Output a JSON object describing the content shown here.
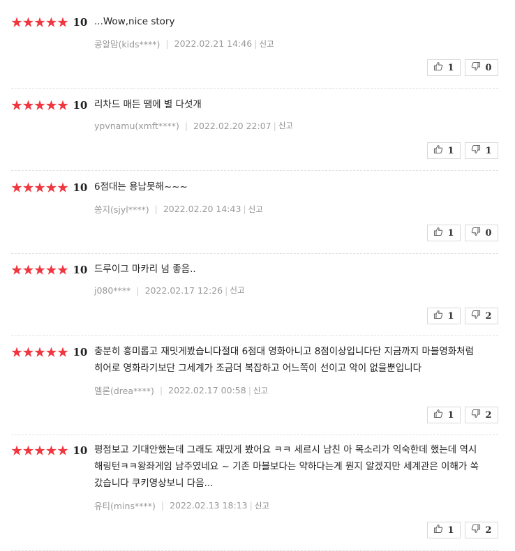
{
  "reviews": [
    {
      "score": "10",
      "text": "...Wow,nice story",
      "author": "콩알맘(kids****)",
      "date": "2022.02.21 14:46",
      "report": "신고",
      "likes": "1",
      "dislikes": "0"
    },
    {
      "score": "10",
      "text": "리차드 매든 땜에 별 다섯개",
      "author": "ypvnamu(xmft****)",
      "date": "2022.02.20 22:07",
      "report": "신고",
      "likes": "1",
      "dislikes": "1"
    },
    {
      "score": "10",
      "text": "6점대는 용납못해~~~",
      "author": "쏭지(sjyl****)",
      "date": "2022.02.20 14:43",
      "report": "신고",
      "likes": "1",
      "dislikes": "0"
    },
    {
      "score": "10",
      "text": "드루이그 마카리 넘 좋음..",
      "author": "j080****",
      "date": "2022.02.17 12:26",
      "report": "신고",
      "likes": "1",
      "dislikes": "2"
    },
    {
      "score": "10",
      "text": "충분히 흥미롭고 재밋게봤습니다절대 6점대 영화아니고 8점이상입니다단 지금까지 마블영화처럼 히어로 영화라기보단 그세계가 조금더 복잡하고 어느쪽이 선이고 악이 없을뿐입니다",
      "author": "멜론(drea****)",
      "date": "2022.02.17 00:58",
      "report": "신고",
      "likes": "1",
      "dislikes": "2"
    },
    {
      "score": "10",
      "text": "평점보고 기대안했는데 그래도 재밌게 봤어요 ㅋㅋ 세르시 남친 아 목소리가 익숙한데 했는데 역시 해링턴ㅋㅋ왕좌게임 남주였네요 ~ 기존 마블보다는 약하다는게 뭔지 알겠지만 세계관은 이해가 쏙 갔습니다 쿠키영상보니 다음...",
      "author": "유티(mins****)",
      "date": "2022.02.13 18:13",
      "report": "신고",
      "likes": "1",
      "dislikes": "2"
    }
  ],
  "colors": {
    "star": "#f0363f",
    "meta": "#999999",
    "border": "#d8d8d8"
  },
  "icons": {
    "like": "thumbs-up-icon",
    "dislike": "thumbs-down-icon",
    "star": "star-icon"
  }
}
